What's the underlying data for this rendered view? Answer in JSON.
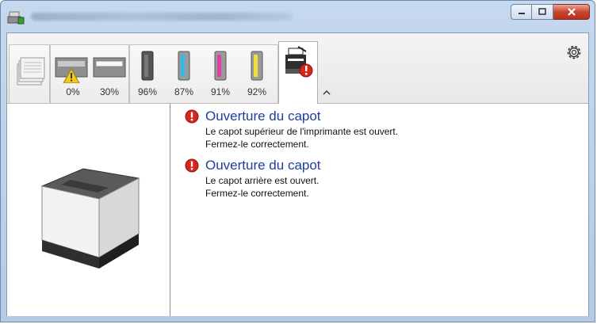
{
  "window": {
    "title": ""
  },
  "toolbar": {
    "levels": [
      {
        "name": "paper-tray-1",
        "value": "0%",
        "warning": true
      },
      {
        "name": "paper-tray-2",
        "value": "30%"
      },
      {
        "name": "toner-black",
        "value": "96%",
        "color": "#505050"
      },
      {
        "name": "toner-cyan",
        "value": "87%",
        "color": "#37b8e6"
      },
      {
        "name": "toner-magenta",
        "value": "91%",
        "color": "#e23fa5"
      },
      {
        "name": "toner-yellow",
        "value": "92%",
        "color": "#f0e03c"
      }
    ],
    "collapse_icon": "chevron-up-icon",
    "settings_icon": "gear-icon"
  },
  "messages": [
    {
      "title": "Ouverture du capot",
      "line1": "Le capot supérieur de l'imprimante est ouvert.",
      "line2": "Fermez-le correctement."
    },
    {
      "title": "Ouverture du capot",
      "line1": "Le capot arrière est ouvert.",
      "line2": "Fermez-le correctement."
    }
  ],
  "colors": {
    "error": "#d7261e",
    "link_title": "#1e3f9e"
  }
}
